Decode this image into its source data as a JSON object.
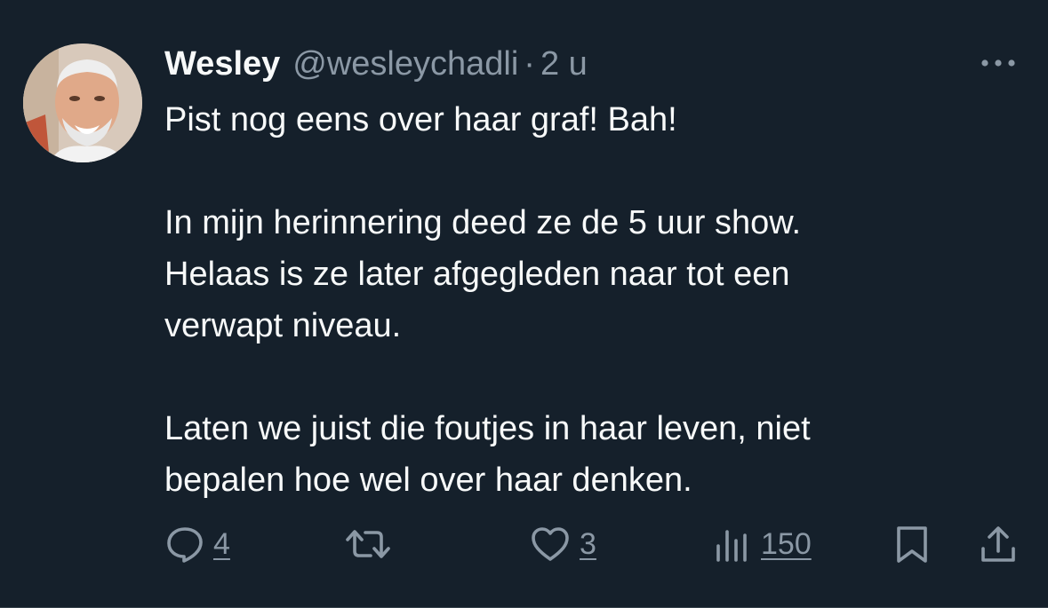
{
  "tweet": {
    "author": {
      "display_name": "Wesley",
      "handle": "@wesleychadli",
      "separator": "·",
      "time": "2 u"
    },
    "body": [
      "Pist nog eens over haar graf! Bah!",
      "",
      "In mijn herinnering deed ze de 5 uur show.",
      "Helaas is ze later afgegleden naar tot een",
      "verwapt niveau.",
      "",
      "Laten we juist die foutjes in haar leven, niet",
      "bepalen hoe wel over haar denken."
    ],
    "actions": {
      "replies": "4",
      "retweets": "",
      "likes": "3",
      "views": "150"
    }
  },
  "icons": {
    "more": "more-horizontal-icon",
    "reply": "reply-icon",
    "retweet": "retweet-icon",
    "like": "heart-icon",
    "views": "views-chart-icon",
    "bookmark": "bookmark-icon",
    "share": "share-icon"
  },
  "colors": {
    "background": "#15202b",
    "text_primary": "#f7f9f9",
    "text_secondary": "#8b98a5"
  }
}
